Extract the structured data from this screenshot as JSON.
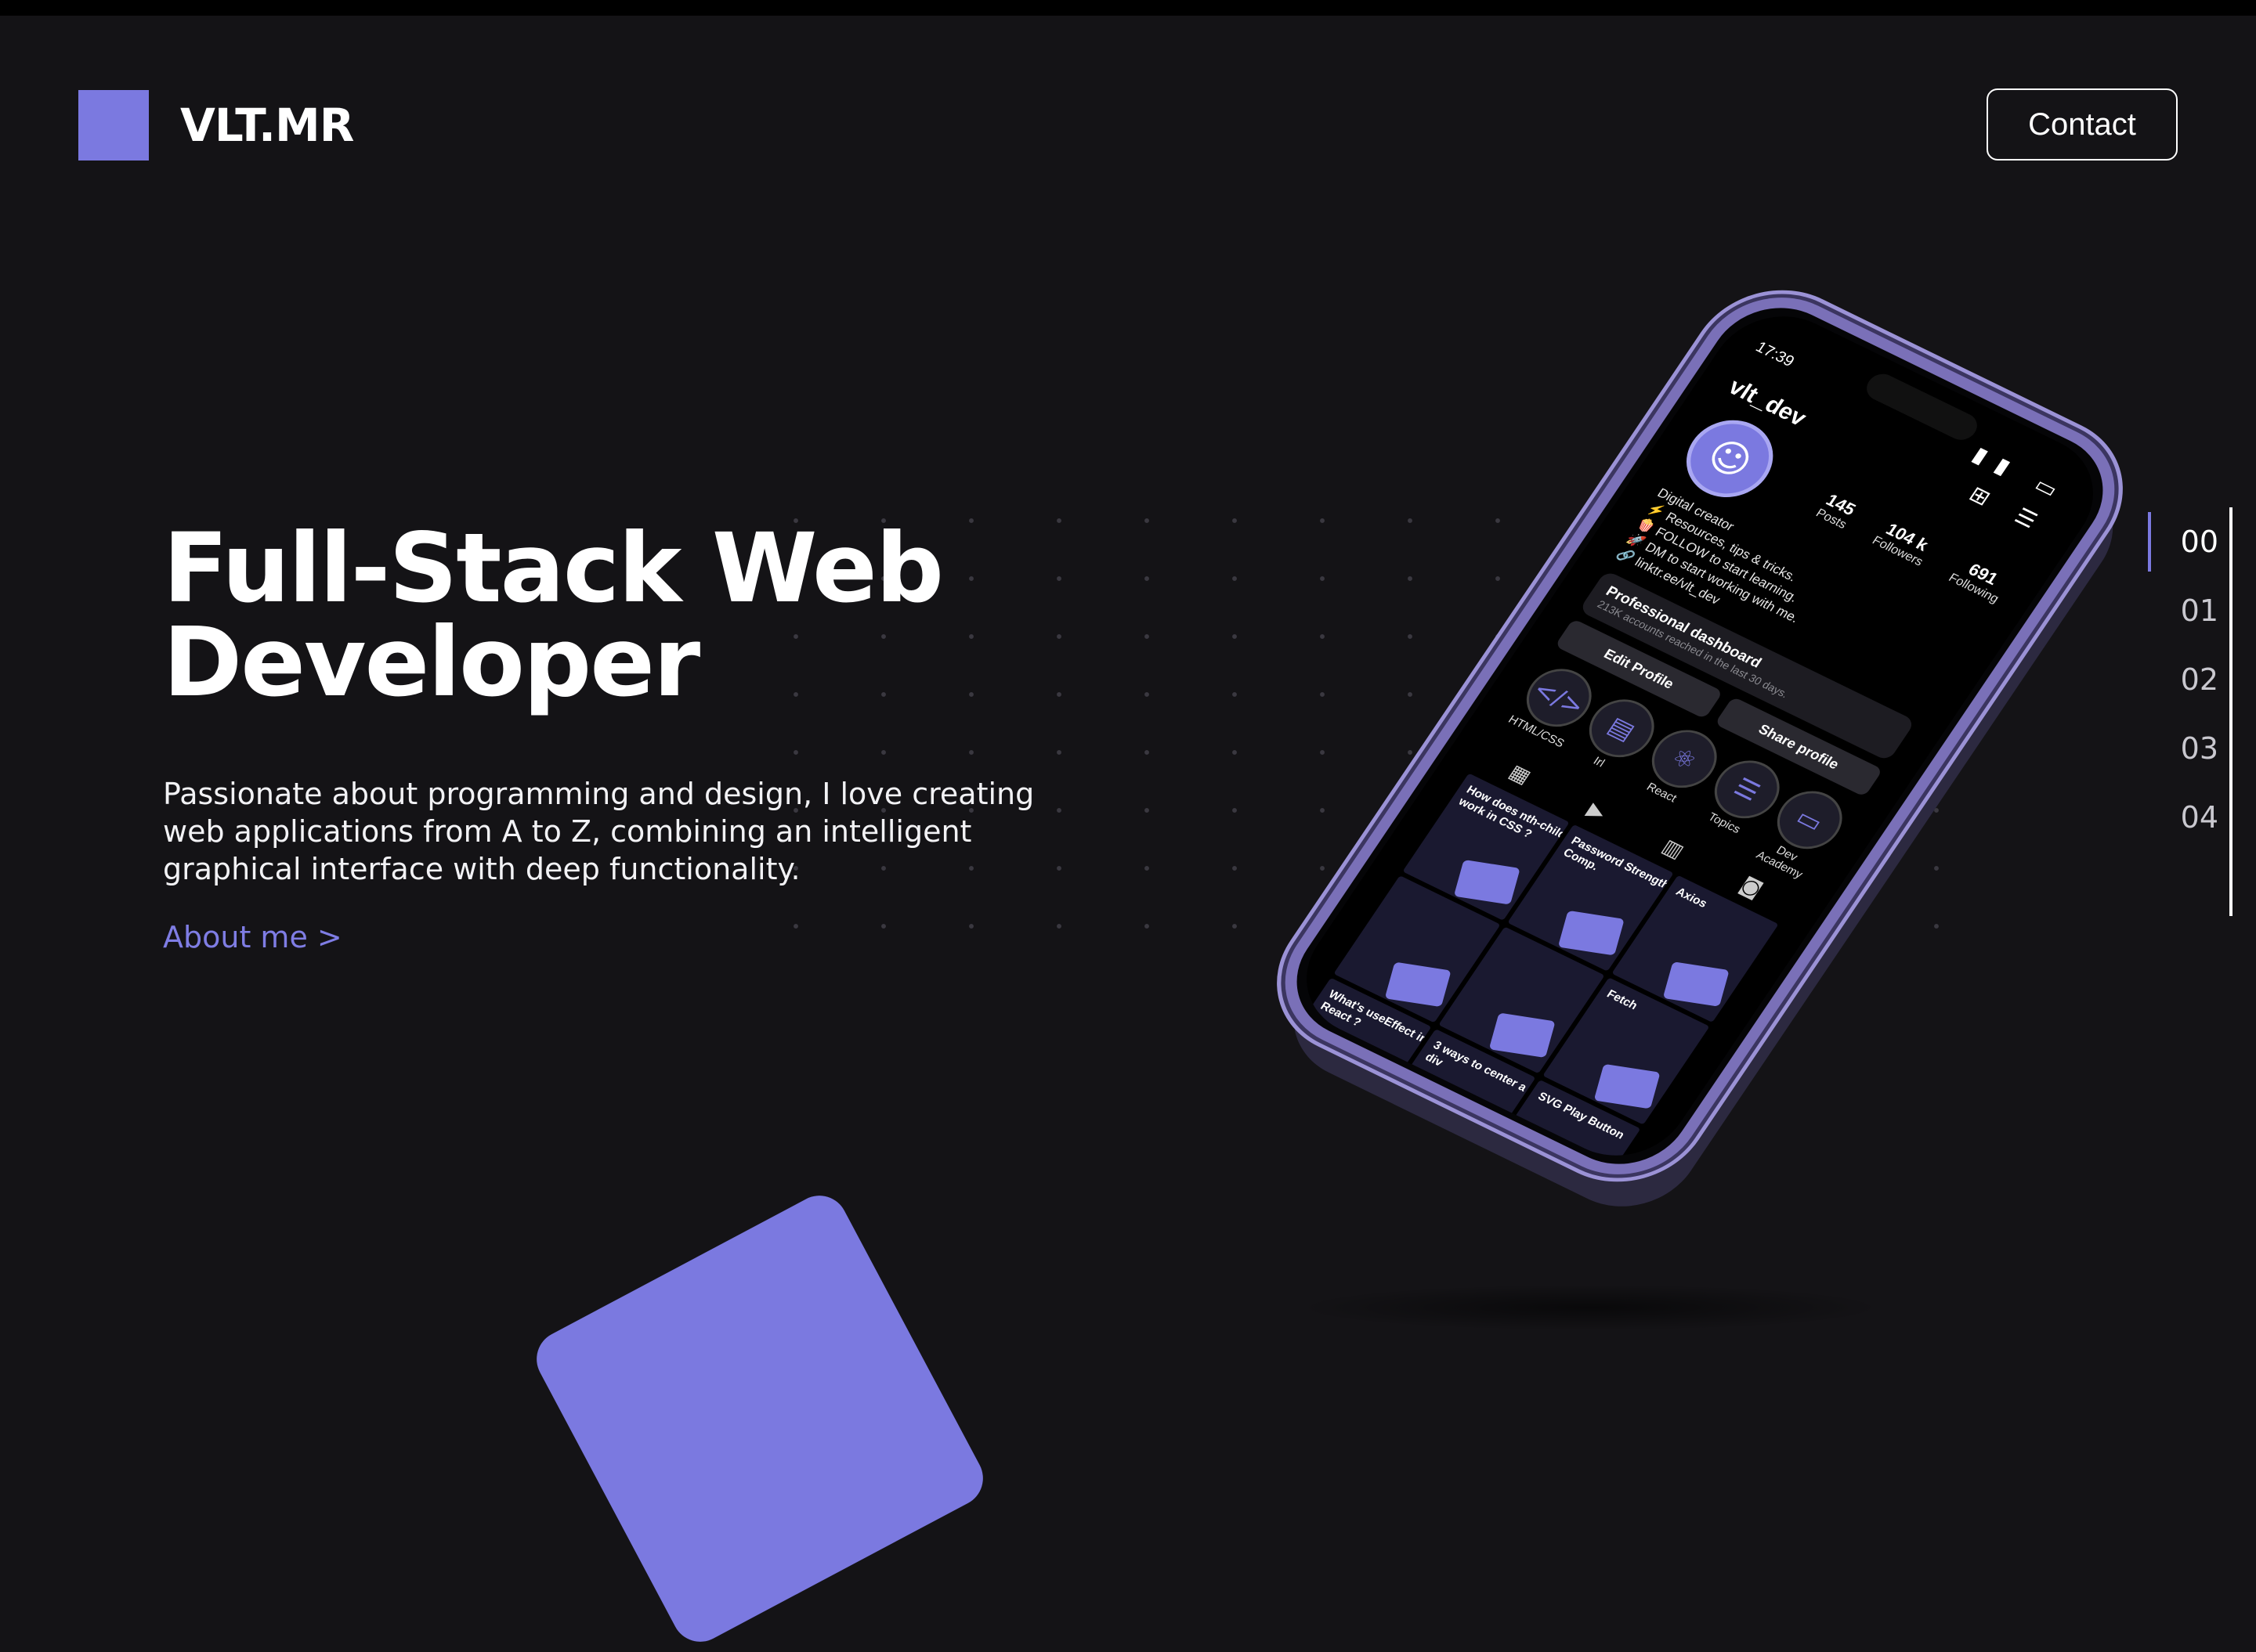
{
  "header": {
    "logo_text": "VLT.MR",
    "contact_label": "Contact"
  },
  "hero": {
    "title_line1": "Full-Stack Web",
    "title_line2": "Developer",
    "intro": "Passionate about programming and design, I love creating web applications from A to Z, combining an intelligent graphical interface with deep functionality.",
    "about_link": "About me >"
  },
  "sidenav": {
    "items": [
      "00",
      "01",
      "02",
      "03",
      "04"
    ],
    "active_index": 0
  },
  "colors": {
    "accent": "#7b79e0",
    "background": "#141316",
    "text": "#ffffff"
  },
  "phone": {
    "time": "17:39",
    "username": "vlt_dev",
    "stats": [
      {
        "value": "145",
        "label": "Posts"
      },
      {
        "value": "104 k",
        "label": "Followers"
      },
      {
        "value": "691",
        "label": "Following"
      }
    ],
    "bio": [
      "Digital creator",
      "⚡ Resources, tips & tricks.",
      "🍿 FOLLOW to start learning.",
      "🚀 DM to start working with me.",
      "🔗 linktr.ee/vlt_dev"
    ],
    "dashboard_title": "Professional dashboard",
    "dashboard_sub": "213K accounts reached in the last 30 days.",
    "edit_profile": "Edit Profile",
    "share_profile": "Share profile",
    "highlights": [
      "HTML/CSS",
      "Irl",
      "React",
      "Topics",
      "Dev Academy"
    ],
    "posts": [
      "How does nth-child work in CSS ?",
      "Password Strength Comp.",
      "Axios",
      "",
      "",
      "Fetch",
      "What's useEffect in React ?",
      "3 ways to center a div",
      "SVG Play Button"
    ]
  }
}
